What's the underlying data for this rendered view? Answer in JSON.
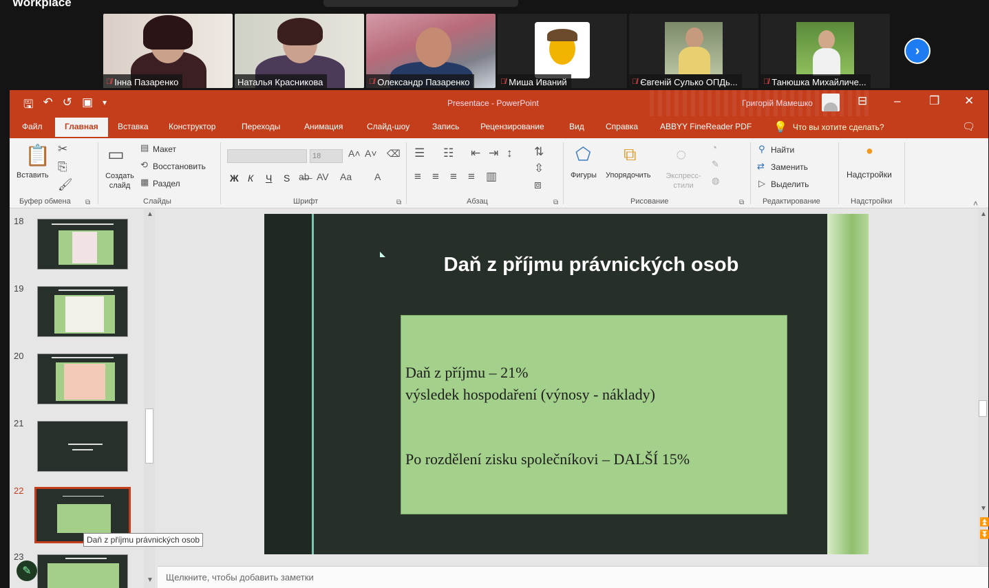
{
  "conference": {
    "title": "Workplace",
    "participants": [
      {
        "name": "Інна Пазаренко",
        "mic_muted": true,
        "active": false
      },
      {
        "name": "Наталья Красникова",
        "mic_muted": true,
        "active": true
      },
      {
        "name": "Олександр Пазаренко",
        "mic_muted": true,
        "active": false
      },
      {
        "name": "Миша Иваний",
        "mic_muted": true,
        "active": false
      },
      {
        "name": "Євгеній Сулько ОПДь...",
        "mic_muted": true,
        "active": false
      },
      {
        "name": "Танюшка Михайличе...",
        "mic_muted": true,
        "active": false
      }
    ],
    "next_icon": "›"
  },
  "ppt": {
    "window_title": "Presentace - PowerPoint",
    "user_name": "Григорій Мамешко",
    "qat": {
      "save": "🖫",
      "undo": "↶",
      "redo": "↺",
      "present": "▣",
      "more": "▾"
    },
    "window_controls": {
      "ribbon_options": "⊟",
      "minimize": "–",
      "restore": "❐",
      "close": "✕"
    },
    "tabs": [
      "Файл",
      "Главная",
      "Вставка",
      "Конструктор",
      "Переходы",
      "Анимация",
      "Слайд-шоу",
      "Запись",
      "Рецензирование",
      "Вид",
      "Справка",
      "ABBYY FineReader PDF"
    ],
    "tell_me": "Что вы хотите сделать?",
    "ribbon": {
      "clipboard": {
        "paste": "Вставить",
        "label": "Буфер обмена"
      },
      "slides": {
        "new_slide": "Создать слайд",
        "layout": "Макет",
        "reset": "Восстановить",
        "section": "Раздел",
        "label": "Слайды"
      },
      "font": {
        "font_size": "18",
        "bold": "Ж",
        "italic": "К",
        "underline": "Ч",
        "strike": "S",
        "label": "Шрифт"
      },
      "paragraph": {
        "label": "Абзац"
      },
      "drawing": {
        "shapes": "Фигуры",
        "arrange": "Упорядочить",
        "quick_styles": "Экспресс-стили",
        "label": "Рисование"
      },
      "editing": {
        "find": "Найти",
        "replace": "Заменить",
        "select": "Выделить",
        "label": "Редактирование"
      },
      "addins": {
        "button": "Надстройки",
        "label": "Надстройки"
      }
    },
    "thumbnails": [
      {
        "num": "18"
      },
      {
        "num": "19"
      },
      {
        "num": "20"
      },
      {
        "num": "21"
      },
      {
        "num": "22",
        "current": true
      },
      {
        "num": "23"
      }
    ],
    "tooltip": "Daň z příjmu právnických osob",
    "slide": {
      "title": "Daň z příjmu právnických osob",
      "line1": "Daň z příjmu – 21%",
      "line2": "výsledek hospodaření (výnosy - náklady)",
      "line3": "Po rozdělení zisku společníkovi – DALŠÍ 15%"
    },
    "notes_placeholder": "Щелкните, чтобы добавить заметки"
  }
}
